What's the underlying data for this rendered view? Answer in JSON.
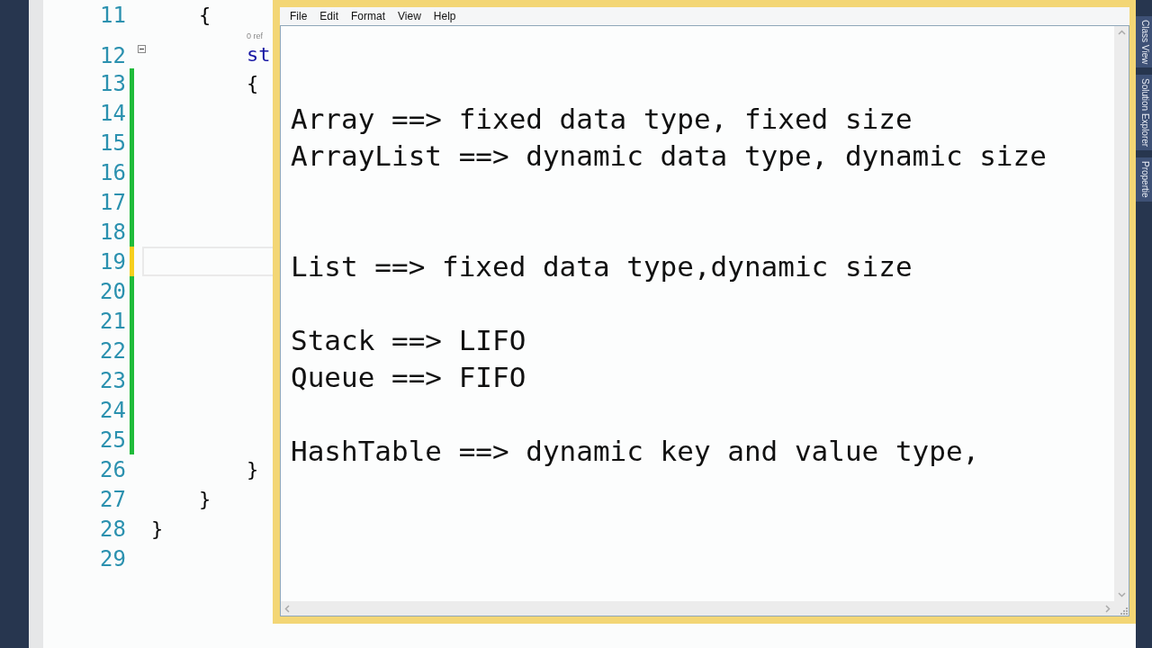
{
  "editor": {
    "lines": [
      {
        "number": "11",
        "code": "    {",
        "changed": false,
        "current": false,
        "foldable": false
      },
      {
        "number": "12",
        "code": "        st",
        "codelens": "0 ref",
        "changed": false,
        "current": false,
        "foldable": true
      },
      {
        "number": "13",
        "code": "        {",
        "changed": true,
        "saved": true,
        "current": false,
        "foldable": false
      },
      {
        "number": "14",
        "changed": true,
        "saved": true,
        "current": false,
        "foldable": false
      },
      {
        "number": "15",
        "changed": true,
        "saved": true,
        "current": false,
        "foldable": false
      },
      {
        "number": "16",
        "changed": true,
        "saved": true,
        "current": false,
        "foldable": false
      },
      {
        "number": "17",
        "changed": true,
        "saved": true,
        "current": false,
        "foldable": false
      },
      {
        "number": "18",
        "changed": true,
        "saved": true,
        "current": false,
        "foldable": false
      },
      {
        "number": "19",
        "changed": true,
        "saved": false,
        "current": true,
        "foldable": false
      },
      {
        "number": "20",
        "changed": true,
        "saved": true,
        "current": false,
        "foldable": false
      },
      {
        "number": "21",
        "changed": true,
        "saved": true,
        "current": false,
        "foldable": false
      },
      {
        "number": "22",
        "changed": true,
        "saved": true,
        "current": false,
        "foldable": false
      },
      {
        "number": "23",
        "changed": true,
        "saved": true,
        "current": false,
        "foldable": false
      },
      {
        "number": "24",
        "changed": true,
        "saved": true,
        "current": false,
        "foldable": false
      },
      {
        "number": "25",
        "changed": true,
        "saved": true,
        "current": false,
        "foldable": false
      },
      {
        "number": "26",
        "code": "        }",
        "changed": false,
        "current": false,
        "foldable": false
      },
      {
        "number": "27",
        "code": "    }",
        "changed": false,
        "current": false,
        "foldable": false
      },
      {
        "number": "28",
        "code": "}",
        "changed": false,
        "current": false,
        "foldable": false
      },
      {
        "number": "29",
        "changed": false,
        "current": false,
        "foldable": false
      }
    ]
  },
  "side_tabs": [
    "Class View",
    "Solution Explorer",
    "Propertie"
  ],
  "notepad": {
    "menu": [
      "File",
      "Edit",
      "Format",
      "View",
      "Help"
    ],
    "text": "\n\nArray ==> fixed data type, fixed size\nArrayList ==> dynamic data type, dynamic size\n\n\nList ==> fixed data type,dynamic size\n\nStack ==> LIFO\nQueue ==> FIFO\n\nHashTable ==> dynamic key and value type,"
  }
}
